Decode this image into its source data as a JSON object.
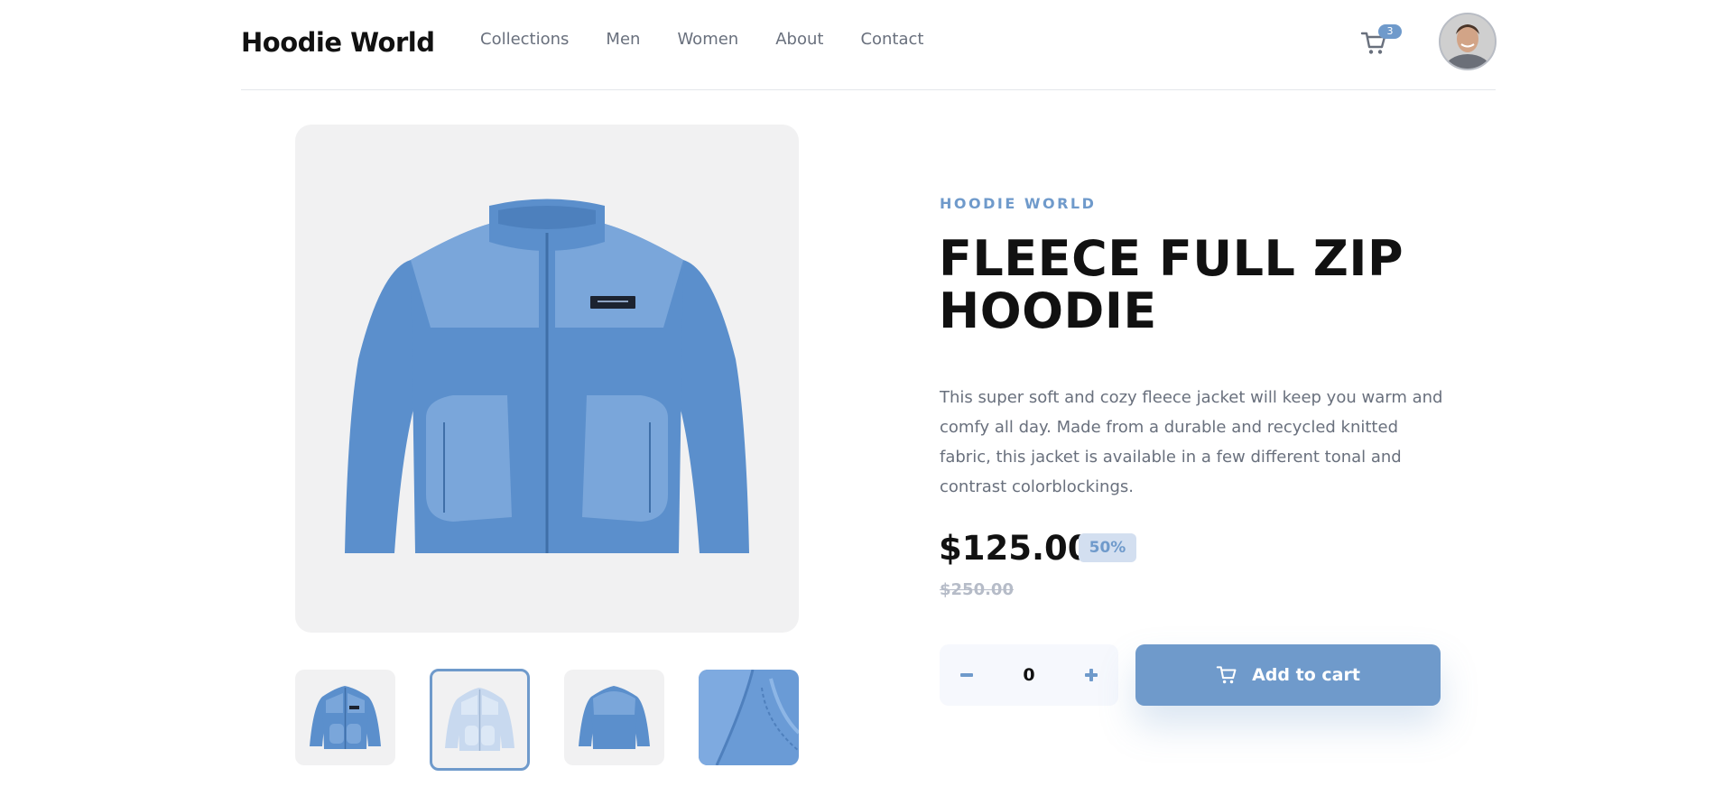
{
  "header": {
    "logo": "Hoodie World",
    "nav": [
      "Collections",
      "Men",
      "Women",
      "About",
      "Contact"
    ],
    "cart_count": "3",
    "cart_icon": "cart-icon",
    "avatar_icon": "user-avatar"
  },
  "gallery": {
    "main_image": "blue fleece full zip jacket",
    "thumbnails": [
      "blue jacket front",
      "light blue jacket front",
      "blue jacket back",
      "fleece fabric detail"
    ],
    "active_thumbnail": 1
  },
  "product": {
    "brand": "HOODIE WORLD",
    "title": "FLEECE FULL ZIP HOODIE",
    "description": "This super soft and cozy fleece jacket will keep you warm and comfy all day. Made from a durable and recycled knitted fabric, this jacket is available in a few different tonal and contrast colorblockings.",
    "price": "$125.00",
    "discount": "50%",
    "old_price": "$250.00",
    "quantity": "0",
    "add_to_cart": "Add to cart"
  },
  "colors": {
    "accent": "#6f9acb",
    "accent_light": "#d3dff0",
    "jacket_blue": "#5b8fcc",
    "jacket_panel": "#7aa6da"
  }
}
